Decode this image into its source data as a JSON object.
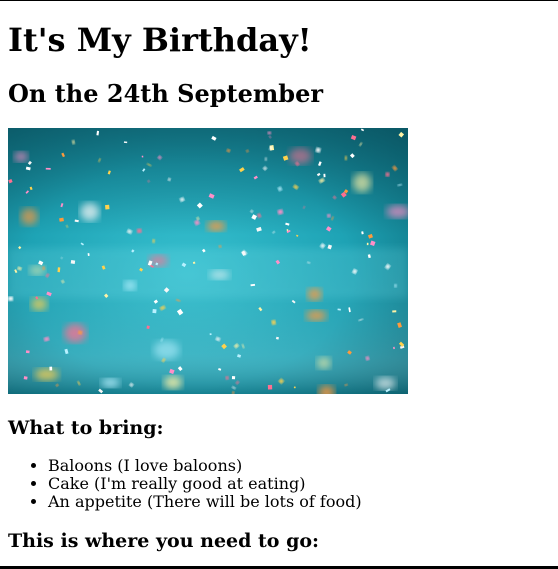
{
  "page": {
    "title": "It's My Birthday!",
    "subtitle": "On the 24th September"
  },
  "hero_image": {
    "description_icon": "confetti-photo",
    "colors": {
      "background_light": "#2fb4c4",
      "background_dark": "#0a5f6e"
    }
  },
  "bring_section": {
    "heading": "What to bring:",
    "items": [
      {
        "label": "Baloons (I love baloons)"
      },
      {
        "label": "Cake (I'm really good at eating)"
      },
      {
        "label": "An appetite (There will be lots of food)"
      }
    ]
  },
  "location_section": {
    "heading": "This is where you need to go:"
  }
}
